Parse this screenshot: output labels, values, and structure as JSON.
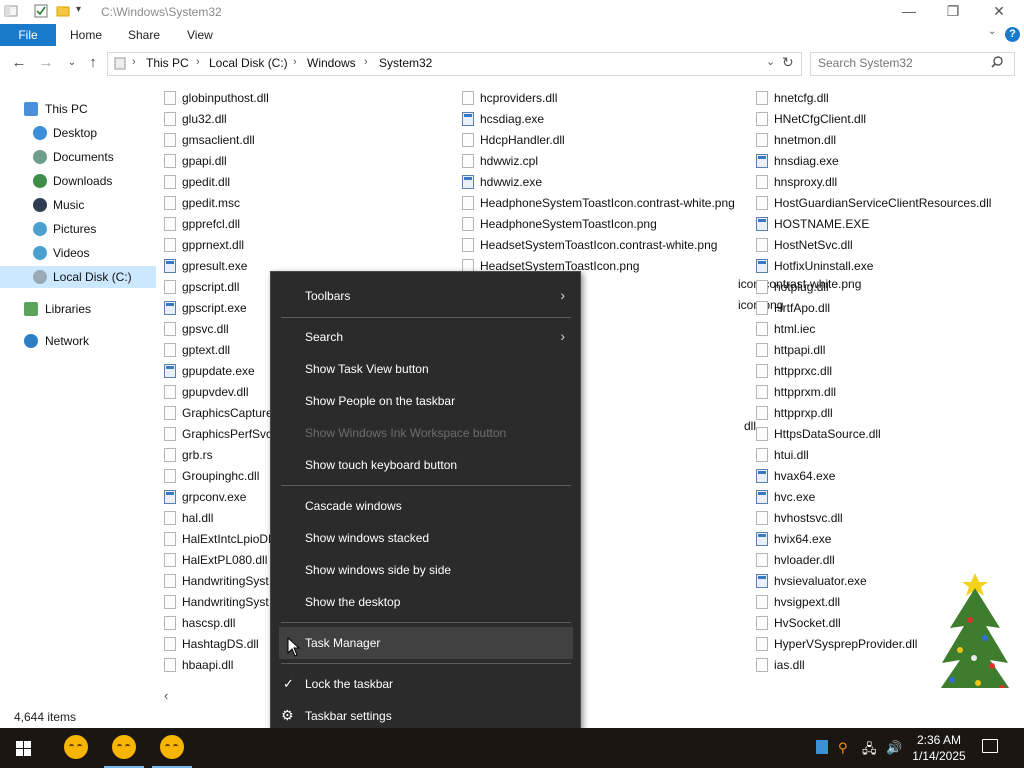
{
  "window": {
    "title": "C:\\Windows\\System32",
    "minimize": "—",
    "maximize": "❐",
    "close": "✕"
  },
  "ribbon": {
    "tabs": [
      "File",
      "Home",
      "Share",
      "View"
    ]
  },
  "address": {
    "breadcrumbs": [
      "This PC",
      "Local Disk (C:)",
      "Windows",
      "System32"
    ],
    "search_placeholder": "Search System32"
  },
  "nav": {
    "items": [
      {
        "label": "This PC",
        "color": "#4a90d9"
      },
      {
        "label": "Desktop",
        "color": "#3a8fd8"
      },
      {
        "label": "Documents",
        "color": "#6f9f8b"
      },
      {
        "label": "Downloads",
        "color": "#3e8e4a"
      },
      {
        "label": "Music",
        "color": "#2f3d52"
      },
      {
        "label": "Pictures",
        "color": "#4a9fcf"
      },
      {
        "label": "Videos",
        "color": "#4a9fcf"
      },
      {
        "label": "Local Disk (C:)",
        "color": "#9aa9b6"
      },
      {
        "label": "Libraries",
        "color": "#59a35d"
      },
      {
        "label": "Network",
        "color": "#2c7fc7"
      }
    ]
  },
  "files": {
    "col1": [
      [
        "globinputhost.dll",
        "dll"
      ],
      [
        "glu32.dll",
        "dll"
      ],
      [
        "gmsaclient.dll",
        "dll"
      ],
      [
        "gpapi.dll",
        "dll"
      ],
      [
        "gpedit.dll",
        "dll"
      ],
      [
        "gpedit.msc",
        "dll"
      ],
      [
        "gpprefcl.dll",
        "dll"
      ],
      [
        "gpprnext.dll",
        "dll"
      ],
      [
        "gpresult.exe",
        "exe"
      ],
      [
        "gpscript.dll",
        "dll"
      ],
      [
        "gpscript.exe",
        "exe"
      ],
      [
        "gpsvc.dll",
        "dll"
      ],
      [
        "gptext.dll",
        "dll"
      ],
      [
        "gpupdate.exe",
        "exe"
      ],
      [
        "gpupvdev.dll",
        "dll"
      ],
      [
        "GraphicsCapture",
        "dll"
      ],
      [
        "GraphicsPerfSvc.",
        "dll"
      ],
      [
        "grb.rs",
        "dll"
      ],
      [
        "Groupinghc.dll",
        "dll"
      ],
      [
        "grpconv.exe",
        "exe"
      ],
      [
        "hal.dll",
        "dll"
      ],
      [
        "HalExtIntcLpioDM",
        "dll"
      ],
      [
        "HalExtPL080.dll",
        "dll"
      ],
      [
        "HandwritingSyst",
        "dll"
      ],
      [
        "HandwritingSyst",
        "dll"
      ],
      [
        "hascsp.dll",
        "dll"
      ],
      [
        "HashtagDS.dll",
        "dll"
      ],
      [
        "hbaapi.dll",
        "dll"
      ]
    ],
    "col2_top": [
      [
        "hcproviders.dll",
        "dll"
      ],
      [
        "hcsdiag.exe",
        "exe"
      ],
      [
        "HdcpHandler.dll",
        "dll"
      ],
      [
        "hdwwiz.cpl",
        "dll"
      ],
      [
        "hdwwiz.exe",
        "exe"
      ],
      [
        "HeadphoneSystemToastIcon.contrast-white.png",
        "dll"
      ],
      [
        "HeadphoneSystemToastIcon.png",
        "dll"
      ],
      [
        "HeadsetSystemToastIcon.contrast-white.png",
        "dll"
      ],
      [
        "HeadsetSystemToastIcon.png",
        "dll"
      ]
    ],
    "col2_partial": [
      {
        "text": "icon.contrast-white.png"
      },
      {
        "text": "icon.png"
      },
      {
        "text": "dll"
      }
    ],
    "col3": [
      [
        "hnetcfg.dll",
        "dll"
      ],
      [
        "HNetCfgClient.dll",
        "dll"
      ],
      [
        "hnetmon.dll",
        "dll"
      ],
      [
        "hnsdiag.exe",
        "exe"
      ],
      [
        "hnsproxy.dll",
        "dll"
      ],
      [
        "HostGuardianServiceClientResources.dll",
        "dll"
      ],
      [
        "HOSTNAME.EXE",
        "exe"
      ],
      [
        "HostNetSvc.dll",
        "dll"
      ],
      [
        "HotfixUninstall.exe",
        "exe"
      ],
      [
        "hotplug.dll",
        "dll"
      ],
      [
        "HrtfApo.dll",
        "dll"
      ],
      [
        "html.iec",
        "dll"
      ],
      [
        "httpapi.dll",
        "dll"
      ],
      [
        "httpprxc.dll",
        "dll"
      ],
      [
        "httpprxm.dll",
        "dll"
      ],
      [
        "httpprxp.dll",
        "dll"
      ],
      [
        "HttpsDataSource.dll",
        "dll"
      ],
      [
        "htui.dll",
        "dll"
      ],
      [
        "hvax64.exe",
        "exe"
      ],
      [
        "hvc.exe",
        "exe"
      ],
      [
        "hvhostsvc.dll",
        "dll"
      ],
      [
        "hvix64.exe",
        "exe"
      ],
      [
        "hvloader.dll",
        "dll"
      ],
      [
        "hvsievaluator.exe",
        "exe"
      ],
      [
        "hvsigpext.dll",
        "dll"
      ],
      [
        "HvSocket.dll",
        "dll"
      ],
      [
        "HyperVSysprepProvider.dll",
        "dll"
      ],
      [
        "ias.dll",
        "dll"
      ]
    ]
  },
  "status": {
    "item_count": "4,644 items"
  },
  "context_menu": {
    "items": [
      {
        "label": "Toolbars",
        "submenu": true
      },
      {
        "label": "Search",
        "submenu": true
      },
      {
        "label": "Show Task View button"
      },
      {
        "label": "Show People on the taskbar"
      },
      {
        "label": "Show Windows Ink Workspace button",
        "disabled": true
      },
      {
        "label": "Show touch keyboard button"
      },
      {
        "label": "Cascade windows"
      },
      {
        "label": "Show windows stacked"
      },
      {
        "label": "Show windows side by side"
      },
      {
        "label": "Show the desktop"
      },
      {
        "label": "Task Manager",
        "hover": true
      },
      {
        "label": "Lock the taskbar",
        "checked": true
      },
      {
        "label": "Taskbar settings",
        "gear": true
      }
    ]
  },
  "taskbar": {
    "time": "2:36 AM",
    "date": "1/14/2025",
    "accent": "#76b9ed"
  }
}
